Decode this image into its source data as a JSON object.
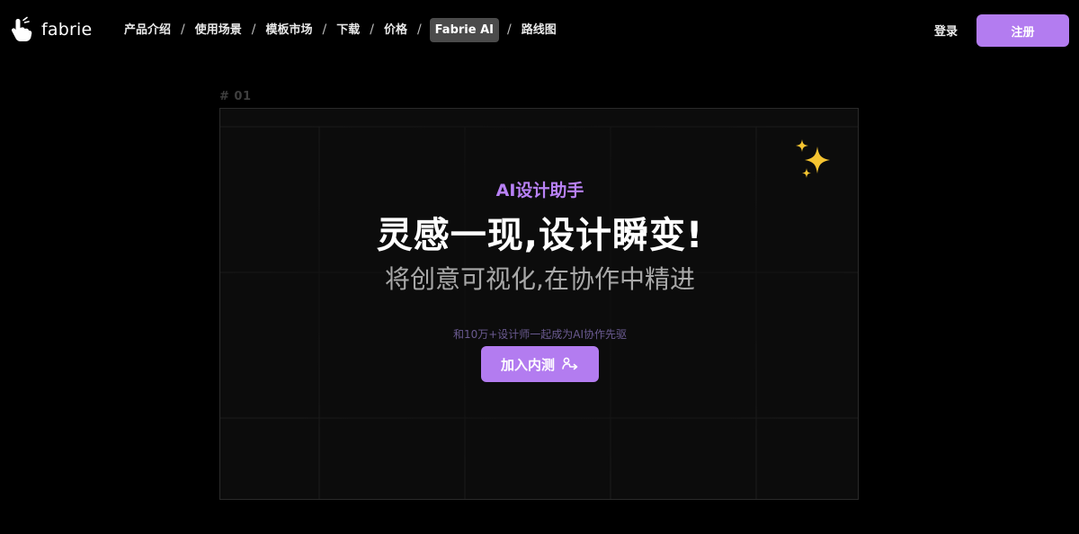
{
  "header": {
    "logo_text": "fabrie",
    "nav": [
      {
        "label": "产品介绍",
        "active": false
      },
      {
        "label": "使用场景",
        "active": false
      },
      {
        "label": "模板市场",
        "active": false
      },
      {
        "label": "下载",
        "active": false
      },
      {
        "label": "价格",
        "active": false
      },
      {
        "label": "Fabrie AI",
        "active": true
      },
      {
        "label": "路线图",
        "active": false
      }
    ],
    "separator": "/",
    "login_label": "登录",
    "signup_label": "注册"
  },
  "section": {
    "label": "# 01"
  },
  "hero": {
    "tagline": "AI设计助手",
    "headline": "灵感一现,设计瞬变!",
    "subheadline": "将创意可视化,在协作中精进",
    "community_text": "和10万+设计师一起成为AI协作先驱",
    "cta_label": "加入内测"
  },
  "colors": {
    "background": "#000000",
    "accent": "#b37cf0",
    "tagline": "#b881f5",
    "card_background": "#0c0c0c",
    "sparkle": "#f4c430"
  },
  "icons": {
    "logo": "hand-pointer-icon",
    "sparkles": "sparkles-icon",
    "cta": "arrow-person-icon"
  }
}
